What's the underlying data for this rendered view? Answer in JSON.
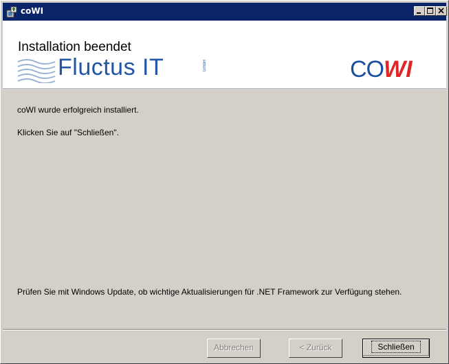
{
  "window": {
    "title": "coWI",
    "controls": [
      "minimize-icon",
      "maximize-icon",
      "close-icon"
    ]
  },
  "header": {
    "title": "Installation beendet",
    "logo_left": "Fluctus IT",
    "logo_left_suffix": "GmbH",
    "logo_right_a": "CO",
    "logo_right_b": "WI"
  },
  "content": {
    "message": "coWI wurde erfolgreich installiert.",
    "instruction": "Klicken Sie auf \"Schließen\".",
    "note": "Prüfen Sie mit Windows Update, ob wichtige Aktualisierungen für .NET Framework zur Verfügung stehen."
  },
  "buttons": {
    "cancel": "Abbrechen",
    "back": "< Zurück",
    "close": "Schließen"
  },
  "colors": {
    "titlebar": "#0a246a",
    "dialog": "#d4d0c8",
    "logo_blue": "#2255a4",
    "logo_red": "#e02626"
  }
}
